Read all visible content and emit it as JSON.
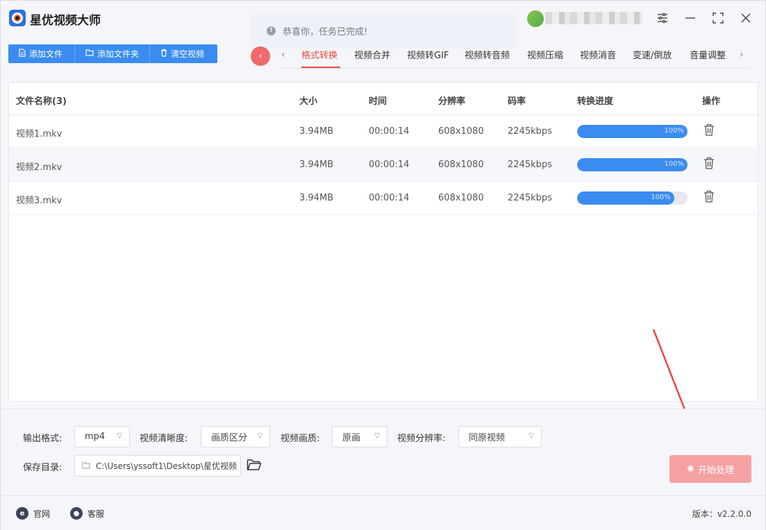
{
  "app": {
    "title": "星优视频大师"
  },
  "toast": {
    "message": "恭喜你，任务已完成!"
  },
  "toolbar": {
    "add_file": "添加文件",
    "add_folder": "添加文件夹",
    "clear_videos": "清空视频"
  },
  "tabs": [
    "格式转换",
    "视频合并",
    "视频转GIF",
    "视频转音频",
    "视频压缩",
    "视频消音",
    "变速/倒放",
    "音量调整"
  ],
  "active_tab": "格式转换",
  "table": {
    "headers": {
      "name": "文件名称(3)",
      "size": "大小",
      "time": "时间",
      "resolution": "分辨率",
      "bitrate": "码率",
      "progress": "转换进度",
      "action": "操作"
    },
    "rows": [
      {
        "name": "视频1.mkv",
        "size": "3.94MB",
        "time": "00:00:14",
        "resolution": "608x1080",
        "bitrate": "2245kbps",
        "progress_label": "100%",
        "progress": 1.0
      },
      {
        "name": "视频2.mkv",
        "size": "3.94MB",
        "time": "00:00:14",
        "resolution": "608x1080",
        "bitrate": "2245kbps",
        "progress_label": "100%",
        "progress": 1.0
      },
      {
        "name": "视频3.mkv",
        "size": "3.94MB",
        "time": "00:00:14",
        "resolution": "608x1080",
        "bitrate": "2245kbps",
        "progress_label": "100%",
        "progress": 0.88
      }
    ]
  },
  "settings": {
    "output_format_label": "输出格式:",
    "output_format_value": "mp4",
    "clarity_label": "视频清晰度:",
    "clarity_value": "画质区分",
    "quality_label": "视频画质:",
    "quality_value": "原画",
    "resolution_label": "视频分辨率:",
    "resolution_value": "同原视频",
    "save_dir_label": "保存目录:",
    "save_dir_value": "C:\\Users\\yssoft1\\Desktop\\星优视频",
    "start_button": "开始处理"
  },
  "statusbar": {
    "website": "官网",
    "support": "客服",
    "version": "版本：v2.2.0.0"
  },
  "colors": {
    "primary": "#3b8cf0",
    "accent_red": "#e9493d",
    "start_button": "#f5a1a1"
  }
}
